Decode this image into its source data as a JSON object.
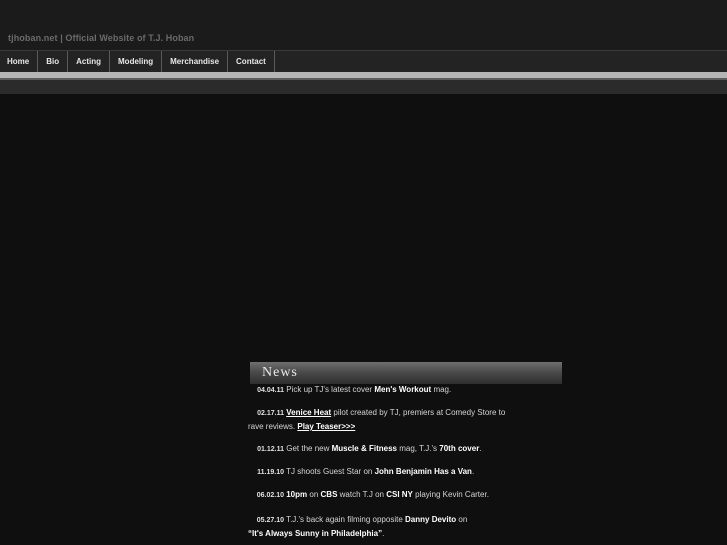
{
  "header": {
    "site_title": "tjhoban.net | Official Website of T.J. Hoban"
  },
  "nav": {
    "items": [
      "Home",
      "Bio",
      "Acting",
      "Modeling",
      "Merchandise",
      "Contact"
    ]
  },
  "news": {
    "title": "News",
    "items": [
      {
        "date": "04.04.11",
        "t1": "Pick up TJ's latest cover",
        "b1": "Men's Workout",
        "t2": "mag."
      },
      {
        "date": "02.17.11",
        "link1": "Venice Heat",
        "t1": "pilot created by TJ, premiers at Comedy Store to",
        "t2": "rave reviews.",
        "link2": "Play Teaser>>>"
      },
      {
        "date": "01.12.11",
        "t1": "Get the new",
        "b1": "Muscle & Fitness",
        "t2": "mag, T.J.'s",
        "b2": "70th cover",
        "t3": "."
      },
      {
        "date": "11.19.10",
        "t1": "TJ shoots Guest Star on",
        "b1": "John Benjamin Has a Van",
        "t2": "."
      },
      {
        "date": "06.02.10",
        "b1": "10pm",
        "t1": "on",
        "b2": "CBS",
        "t2": "watch T.J on",
        "b3": "CSI NY",
        "t3": "playing Kevin Carter."
      },
      {
        "date": "05.27.10",
        "t1": "T.J.'s back again filming opposite",
        "b1": "Danny Devito",
        "t2": "on",
        "b2": "“It's Always Sunny in Philadelphia”",
        "t3": "."
      }
    ]
  },
  "colors": {
    "background": "#0f0f0f",
    "header_band": "#1b1b1b",
    "nav_bar": "#232323",
    "nav_rule": "#b5b5b5"
  }
}
